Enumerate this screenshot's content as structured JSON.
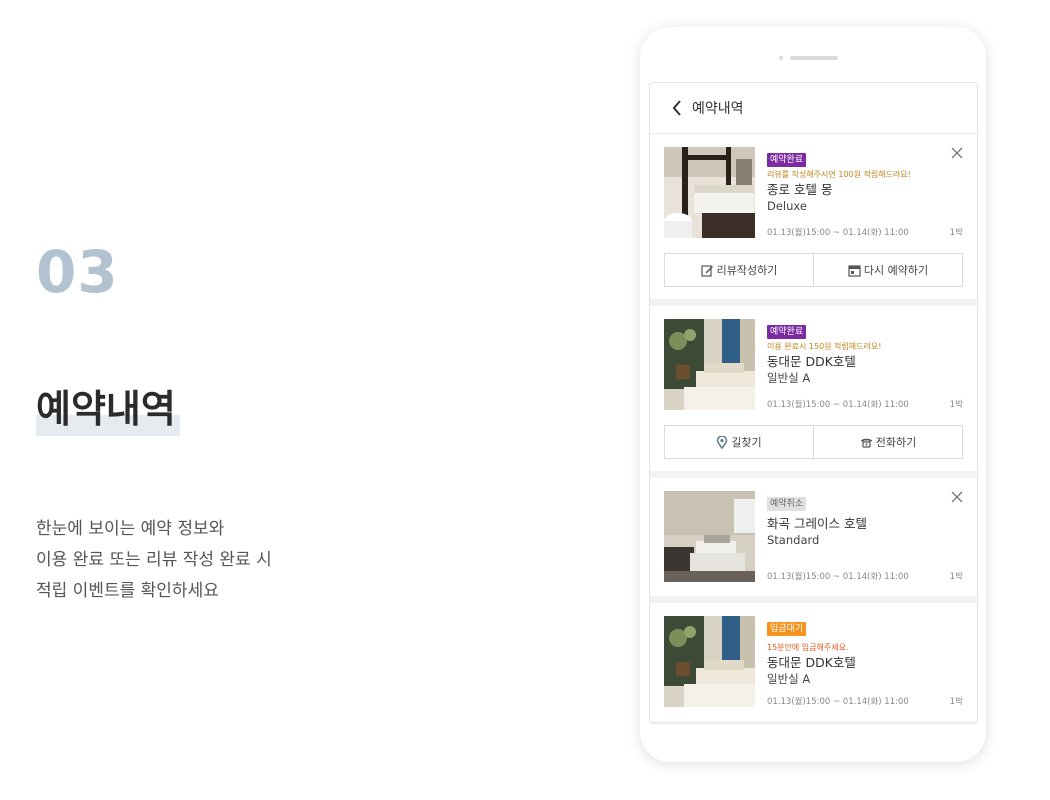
{
  "promo": {
    "step": "03",
    "title": "예약내역",
    "desc_lines": [
      "한눈에 보이는 예약 정보와",
      "이용 완료 또는 리뷰 작성 완료 시",
      "적립 이벤트를 확인하세요"
    ]
  },
  "app": {
    "header_title": "예약내역",
    "icons": {
      "back": "chevron-left-icon",
      "close": "close-icon",
      "review": "edit-icon",
      "rebook": "calendar-icon",
      "directions": "location-pin-icon",
      "call": "phone-icon"
    }
  },
  "reservations": [
    {
      "status": "예약완료",
      "notice": "리뷰를 작성해주시면 100원 적립해드려요!",
      "hotel": "종로 호텔 몽",
      "room": "Deluxe",
      "dates": "01.13(월)15:00 ~ 01.14(화) 11:00",
      "nights": "1박",
      "actions": [
        "리뷰작성하기",
        "다시 예약하기"
      ]
    },
    {
      "status": "예약완료",
      "notice": "이용 완료시 150원 적립해드려요!",
      "hotel": "동대문 DDK호텔",
      "room": "일반실 A",
      "dates": "01.13(월)15:00 ~ 01.14(화) 11:00",
      "nights": "1박",
      "actions": [
        "길찾기",
        "전화하기"
      ]
    },
    {
      "status": "예약취소",
      "hotel": "화곡 그레이스 호텔",
      "room": "Standard",
      "dates": "01.13(월)15:00 ~ 01.14(화) 11:00",
      "nights": "1박"
    },
    {
      "status": "입금대기",
      "notice": "15분안에 입금해주세요.",
      "hotel": "동대문 DDK호텔",
      "room": "일반실 A",
      "dates": "01.13(월)15:00 ~ 01.14(화) 11:00",
      "nights": "1박"
    }
  ],
  "colors": {
    "status_done": "#7c2aa1",
    "status_cancel": "#e0e0e0",
    "status_wait": "#f6931e",
    "notice": "#c4831a",
    "step_number": "#b3c2d1"
  }
}
